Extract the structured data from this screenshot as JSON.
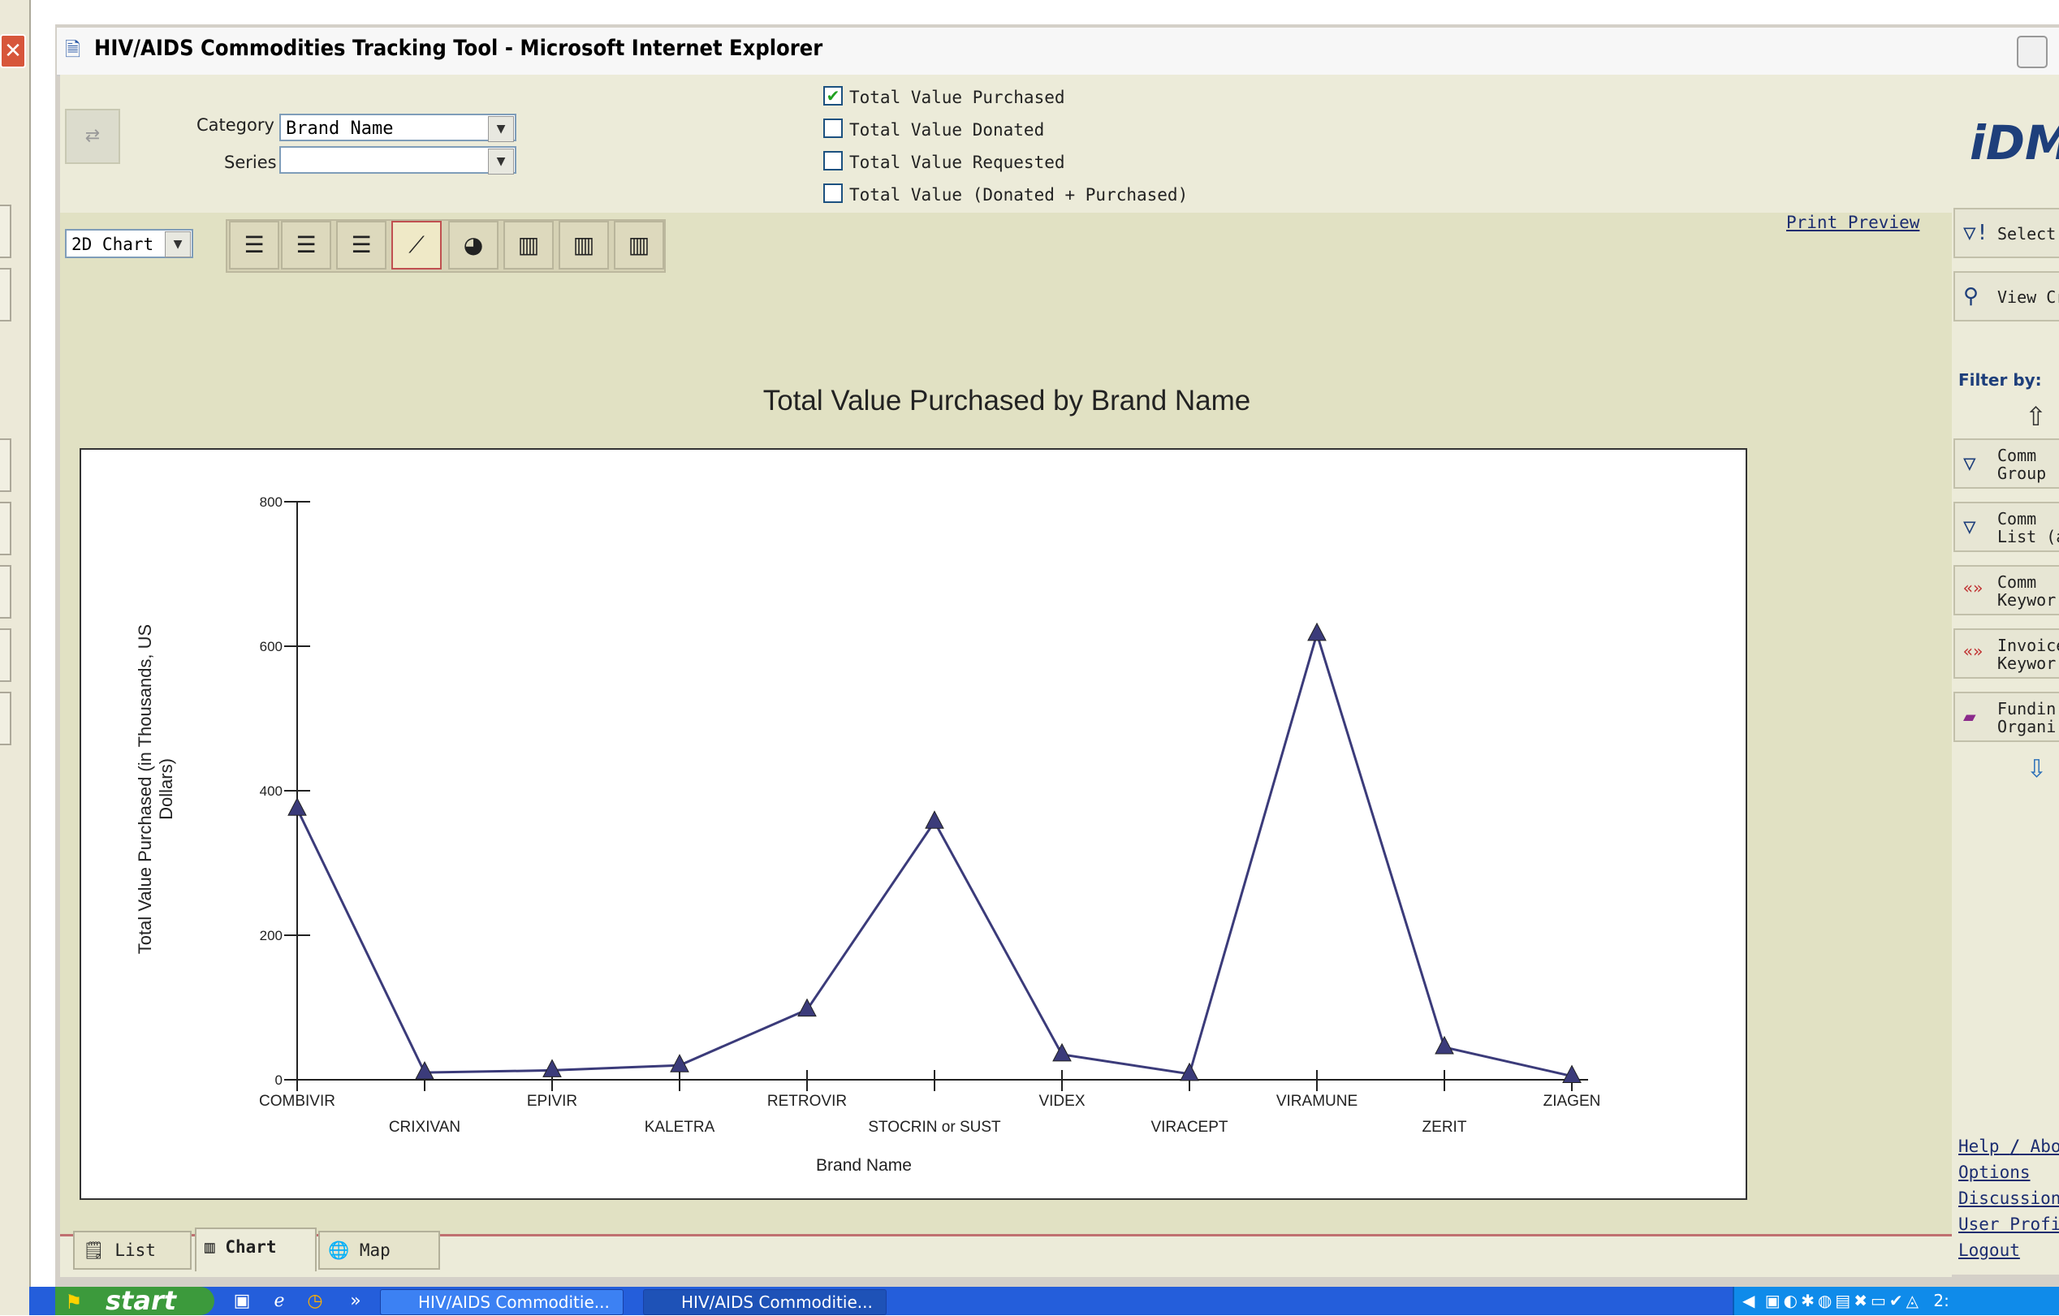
{
  "window": {
    "title": "HIV/AIDS Commodities Tracking Tool - Microsoft Internet Explorer"
  },
  "filters": {
    "category_label": "Category",
    "category_value": "Brand Name",
    "series_label": "Series",
    "series_value": ""
  },
  "measures": [
    {
      "label": "Total Value Purchased",
      "checked": true
    },
    {
      "label": "Total Value Donated",
      "checked": false
    },
    {
      "label": "Total Value Requested",
      "checked": false
    },
    {
      "label": "Total Value (Donated + Purchased)",
      "checked": false
    }
  ],
  "toolbar": {
    "chart_mode": "2D Chart",
    "print_preview": "Print Preview"
  },
  "side_panel": {
    "select_label": "Select",
    "view_label": "View Cr",
    "filter_by": "Filter by:",
    "items": [
      {
        "line1": "Comm",
        "line2": "Group",
        "icon": "funnel-icon"
      },
      {
        "line1": "Comm",
        "line2": "List (al",
        "icon": "funnel-icon"
      },
      {
        "line1": "Comm",
        "line2": "Keywor",
        "icon": "abc-keyword-icon"
      },
      {
        "line1": "Invoice",
        "line2": "Keywor",
        "icon": "abc-keyword-icon"
      },
      {
        "line1": "Fundin",
        "line2": "Organi",
        "icon": "book-icon"
      }
    ],
    "links": [
      "Help",
      "/",
      "Abo",
      "Options",
      "Discussion",
      "User Profile",
      "Logout"
    ]
  },
  "tabs": [
    {
      "label": "List",
      "active": false
    },
    {
      "label": "Chart",
      "active": true
    },
    {
      "label": "Map",
      "active": false
    }
  ],
  "taskbar": {
    "start": "start",
    "tasks": [
      "HIV/AIDS Commoditie...",
      "HIV/AIDS Commoditie..."
    ],
    "clock": "2:"
  },
  "chart_data": {
    "type": "line",
    "title": "Total Value Purchased by Brand Name",
    "xlabel": "Brand Name",
    "ylabel": "Total Value Purchased  (in Thousands, US Dollars)",
    "ylim": [
      0,
      800
    ],
    "yticks": [
      0,
      200,
      400,
      600,
      800
    ],
    "categories": [
      "COMBIVIR",
      "CRIXIVAN",
      "EPIVIR",
      "KALETRA",
      "RETROVIR",
      "STOCRIN or SUST",
      "VIDEX",
      "VIRACEPT",
      "VIRAMUNE",
      "ZERIT",
      "ZIAGEN"
    ],
    "series": [
      {
        "values": [
          375,
          10,
          13,
          20,
          97,
          357,
          35,
          8,
          617,
          45,
          5
        ],
        "color": "#3b3b7a"
      }
    ],
    "grid": false,
    "legend": "none"
  }
}
